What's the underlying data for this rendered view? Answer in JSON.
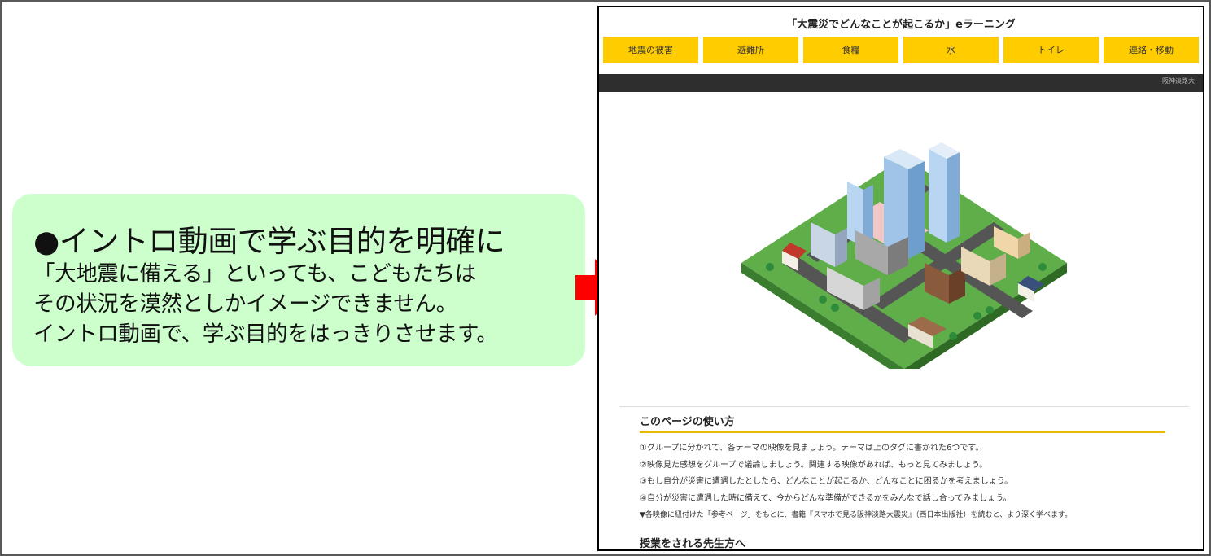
{
  "callout": {
    "title": "●イントロ動画で学ぶ目的を明確に",
    "lines": [
      "「大地震に備える」といっても、こどもたちは",
      "その状況を漠然としかイメージできません。",
      "イントロ動画で、学ぶ目的をはっきりさせます。"
    ],
    "background_color": "#ccffcc"
  },
  "arrow_color": "#ff0000",
  "screenshot": {
    "site_title": "「大震災でどんなことが起こるか」eラーニング",
    "tabs": [
      "地震の被害",
      "避難所",
      "食糧",
      "水",
      "トイレ",
      "連絡・移動"
    ],
    "tab_color": "#ffcc00",
    "map_label": "阪神淡路大",
    "illustration": "isometric-city-illustration",
    "howto": {
      "title": "このページの使い方",
      "steps": [
        "①グループに分かれて、各テーマの映像を見ましょう。テーマは上のタグに書かれた6つです。",
        "②映像見た感想をグループで議論しましょう。関連する映像があれば、もっと見てみましょう。",
        "③もし自分が災害に遭遇したとしたら、どんなことが起こるか、どんなことに困るかを考えましょう。",
        "④自分が災害に遭遇した時に備えて、今からどんな準備ができるかをみんなで話し合ってみましょう。"
      ],
      "note": "▼各映像に紐付けた「参考ページ」をもとに、書籍『スマホで見る阪神淡路大震災』（西日本出版社）を読むと、より深く学べます。"
    },
    "teacher_title": "授業をされる先生方へ"
  }
}
